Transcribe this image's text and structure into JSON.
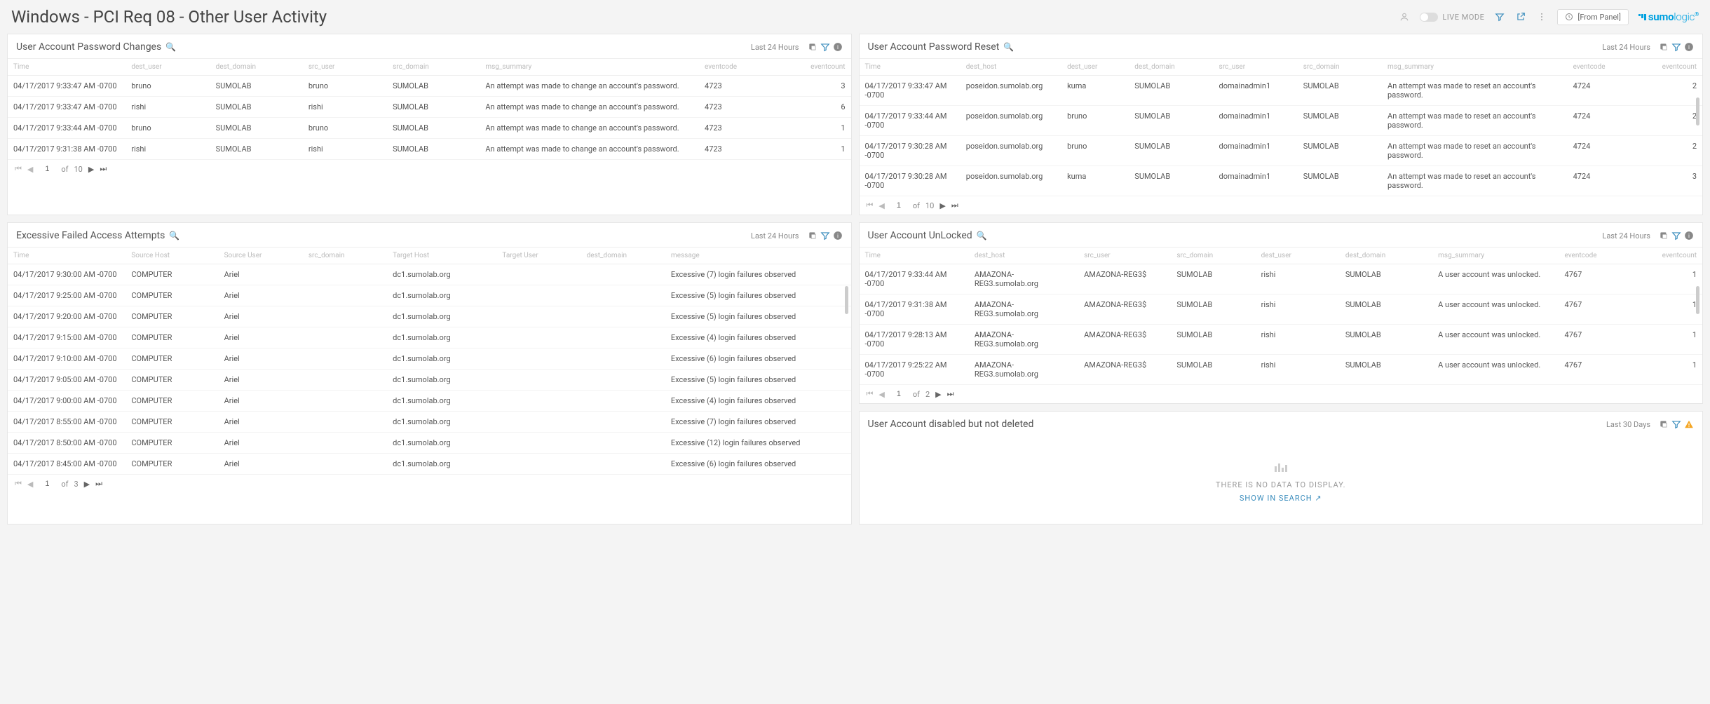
{
  "page_title": "Windows - PCI Req 08 - Other User Activity",
  "header": {
    "live_label": "LIVE MODE",
    "time_label": "[From Panel]",
    "logo_bold": "sumo",
    "logo_light": "logic"
  },
  "panels": {
    "pwchanges": {
      "title": "User Account Password Changes",
      "range": "Last 24 Hours",
      "columns": [
        "Time",
        "dest_user",
        "dest_domain",
        "src_user",
        "src_domain",
        "msg_summary",
        "eventcode",
        "eventcount"
      ],
      "rows": [
        [
          "04/17/2017 9:33:47 AM -0700",
          "bruno",
          "SUMOLAB",
          "bruno",
          "SUMOLAB",
          "An attempt was made to change an account's password.",
          "4723",
          "3"
        ],
        [
          "04/17/2017 9:33:47 AM -0700",
          "rishi",
          "SUMOLAB",
          "rishi",
          "SUMOLAB",
          "An attempt was made to change an account's password.",
          "4723",
          "6"
        ],
        [
          "04/17/2017 9:33:44 AM -0700",
          "bruno",
          "SUMOLAB",
          "bruno",
          "SUMOLAB",
          "An attempt was made to change an account's password.",
          "4723",
          "1"
        ],
        [
          "04/17/2017 9:31:38 AM -0700",
          "rishi",
          "SUMOLAB",
          "rishi",
          "SUMOLAB",
          "An attempt was made to change an account's password.",
          "4723",
          "1"
        ]
      ],
      "pager": {
        "page": "1",
        "of": "of",
        "total": "10"
      }
    },
    "pwreset": {
      "title": "User Account Password Reset",
      "range": "Last 24 Hours",
      "columns": [
        "Time",
        "dest_host",
        "dest_user",
        "dest_domain",
        "src_user",
        "src_domain",
        "msg_summary",
        "eventcode",
        "eventcount"
      ],
      "rows": [
        [
          "04/17/2017 9:33:47 AM -0700",
          "poseidon.sumolab.org",
          "kuma",
          "SUMOLAB",
          "domainadmin1",
          "SUMOLAB",
          "An attempt was made to reset an account's password.",
          "4724",
          "2"
        ],
        [
          "04/17/2017 9:33:44 AM -0700",
          "poseidon.sumolab.org",
          "bruno",
          "SUMOLAB",
          "domainadmin1",
          "SUMOLAB",
          "An attempt was made to reset an account's password.",
          "4724",
          "2"
        ],
        [
          "04/17/2017 9:30:28 AM -0700",
          "poseidon.sumolab.org",
          "bruno",
          "SUMOLAB",
          "domainadmin1",
          "SUMOLAB",
          "An attempt was made to reset an account's password.",
          "4724",
          "2"
        ],
        [
          "04/17/2017 9:30:28 AM -0700",
          "poseidon.sumolab.org",
          "kuma",
          "SUMOLAB",
          "domainadmin1",
          "SUMOLAB",
          "An attempt was made to reset an account's password.",
          "4724",
          "3"
        ]
      ],
      "pager": {
        "page": "1",
        "of": "of",
        "total": "10"
      }
    },
    "failed": {
      "title": "Excessive Failed Access Attempts",
      "range": "Last 24 Hours",
      "columns": [
        "Time",
        "Source Host",
        "Source User",
        "src_domain",
        "Target Host",
        "Target User",
        "dest_domain",
        "message"
      ],
      "rows": [
        [
          "04/17/2017 9:30:00 AM -0700",
          "COMPUTER",
          "Ariel",
          "",
          "dc1.sumolab.org",
          "",
          "",
          "Excessive (7) login failures observed"
        ],
        [
          "04/17/2017 9:25:00 AM -0700",
          "COMPUTER",
          "Ariel",
          "",
          "dc1.sumolab.org",
          "",
          "",
          "Excessive (5) login failures observed"
        ],
        [
          "04/17/2017 9:20:00 AM -0700",
          "COMPUTER",
          "Ariel",
          "",
          "dc1.sumolab.org",
          "",
          "",
          "Excessive (5) login failures observed"
        ],
        [
          "04/17/2017 9:15:00 AM -0700",
          "COMPUTER",
          "Ariel",
          "",
          "dc1.sumolab.org",
          "",
          "",
          "Excessive (4) login failures observed"
        ],
        [
          "04/17/2017 9:10:00 AM -0700",
          "COMPUTER",
          "Ariel",
          "",
          "dc1.sumolab.org",
          "",
          "",
          "Excessive (6) login failures observed"
        ],
        [
          "04/17/2017 9:05:00 AM -0700",
          "COMPUTER",
          "Ariel",
          "",
          "dc1.sumolab.org",
          "",
          "",
          "Excessive (5) login failures observed"
        ],
        [
          "04/17/2017 9:00:00 AM -0700",
          "COMPUTER",
          "Ariel",
          "",
          "dc1.sumolab.org",
          "",
          "",
          "Excessive (4) login failures observed"
        ],
        [
          "04/17/2017 8:55:00 AM -0700",
          "COMPUTER",
          "Ariel",
          "",
          "dc1.sumolab.org",
          "",
          "",
          "Excessive (7) login failures observed"
        ],
        [
          "04/17/2017 8:50:00 AM -0700",
          "COMPUTER",
          "Ariel",
          "",
          "dc1.sumolab.org",
          "",
          "",
          "Excessive (12) login failures observed"
        ],
        [
          "04/17/2017 8:45:00 AM -0700",
          "COMPUTER",
          "Ariel",
          "",
          "dc1.sumolab.org",
          "",
          "",
          "Excessive (6) login failures observed"
        ]
      ],
      "pager": {
        "page": "1",
        "of": "of",
        "total": "3"
      }
    },
    "unlocked": {
      "title": "User Account UnLocked",
      "range": "Last 24 Hours",
      "columns": [
        "Time",
        "dest_host",
        "src_user",
        "src_domain",
        "dest_user",
        "dest_domain",
        "msg_summary",
        "eventcode",
        "eventcount"
      ],
      "rows": [
        [
          "04/17/2017 9:33:44 AM -0700",
          "AMAZONA-REG3.sumolab.org",
          "AMAZONA-REG3$",
          "SUMOLAB",
          "rishi",
          "SUMOLAB",
          "A user account was unlocked.",
          "4767",
          "1"
        ],
        [
          "04/17/2017 9:31:38 AM -0700",
          "AMAZONA-REG3.sumolab.org",
          "AMAZONA-REG3$",
          "SUMOLAB",
          "rishi",
          "SUMOLAB",
          "A user account was unlocked.",
          "4767",
          "1"
        ],
        [
          "04/17/2017 9:28:13 AM -0700",
          "AMAZONA-REG3.sumolab.org",
          "AMAZONA-REG3$",
          "SUMOLAB",
          "rishi",
          "SUMOLAB",
          "A user account was unlocked.",
          "4767",
          "1"
        ],
        [
          "04/17/2017 9:25:22 AM -0700",
          "AMAZONA-REG3.sumolab.org",
          "AMAZONA-REG3$",
          "SUMOLAB",
          "rishi",
          "SUMOLAB",
          "A user account was unlocked.",
          "4767",
          "1"
        ]
      ],
      "pager": {
        "page": "1",
        "of": "of",
        "total": "2"
      }
    },
    "disabled": {
      "title": "User Account disabled but not deleted",
      "range": "Last 30 Days",
      "nodata_msg": "THERE IS NO DATA TO DISPLAY.",
      "show_link": "SHOW IN SEARCH"
    }
  }
}
